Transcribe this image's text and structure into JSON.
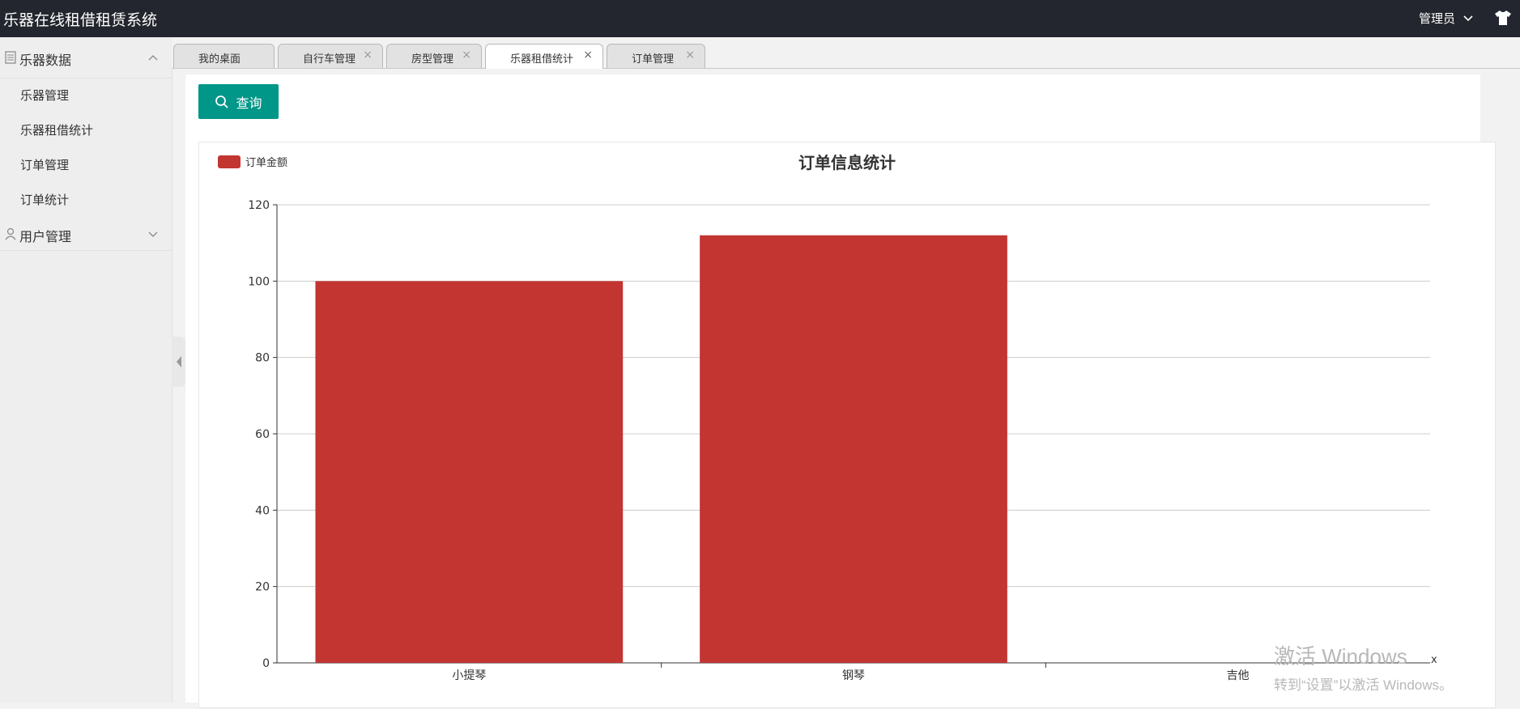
{
  "app": {
    "title": "乐器在线租借租赁系统",
    "user": "管理员"
  },
  "sidebar": {
    "groups": [
      {
        "label": "乐器数据",
        "expanded": true,
        "items": [
          {
            "label": "乐器管理"
          },
          {
            "label": "乐器租借统计"
          },
          {
            "label": "订单管理"
          },
          {
            "label": "订单统计"
          }
        ]
      },
      {
        "label": "用户管理",
        "expanded": false,
        "items": []
      }
    ]
  },
  "tabs": [
    {
      "label": "我的桌面",
      "closable": false,
      "active": false
    },
    {
      "label": "自行车管理",
      "closable": true,
      "active": false
    },
    {
      "label": "房型管理",
      "closable": true,
      "active": false
    },
    {
      "label": "乐器租借统计",
      "closable": true,
      "active": true
    },
    {
      "label": "订单管理",
      "closable": true,
      "active": false
    }
  ],
  "toolbar": {
    "query_label": "查询"
  },
  "colors": {
    "header": "#23262e",
    "accent": "#009688",
    "bar": "#c23531"
  },
  "chart_data": {
    "type": "bar",
    "title": "订单信息统计",
    "legend": [
      "订单金额"
    ],
    "legend_position": "top-left",
    "grid": true,
    "categories": [
      "小提琴",
      "钢琴",
      "吉他"
    ],
    "series": [
      {
        "name": "订单金额",
        "values": [
          100,
          112,
          0
        ]
      }
    ],
    "ylim": [
      0,
      120
    ],
    "yticks": [
      0,
      20,
      40,
      60,
      80,
      100,
      120
    ]
  },
  "watermark": {
    "line1": "激活 Windows",
    "line2": "转到“设置”以激活 Windows。",
    "close": "x"
  }
}
